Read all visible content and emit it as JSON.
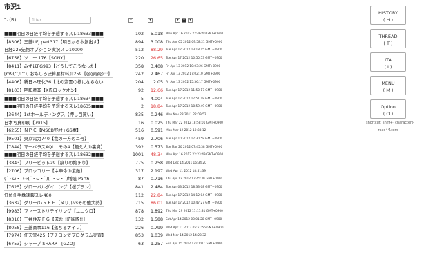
{
  "header": {
    "title": "市況1"
  },
  "toolbar": {
    "refresh_label": "ᔐ (R)",
    "filter_placeholder": "filter",
    "sort_buttons": [
      "▼",
      "▼",
      "▼",
      "▼",
      "▼"
    ]
  },
  "colors": {
    "hot_speed": "#dd3333",
    "text": "#222222"
  },
  "columns": [
    "name",
    "count",
    "speed",
    "created"
  ],
  "threads": [
    {
      "name": "■■■明日の日経平均を予想するスレ18633■■■",
      "count": "102",
      "speed": "5.018",
      "date": "Mon Apr 16 2012 22:46:40 GMT+0900",
      "hot": false
    },
    {
      "name": "【8306】三菱UFJ part317【明日から本気出す】",
      "count": "894",
      "speed": "3.008",
      "date": "Thu Apr 05 2012 09:58:21 GMT+0900",
      "hot": false
    },
    {
      "name": "日経225先物オプション実況スレ10000",
      "count": "512",
      "speed": "88.29",
      "date": "Tue Apr 17 2012 13:18:15 GMT+0900",
      "hot": true
    },
    {
      "name": "【6758】ソニー 176【SONY】",
      "count": "220",
      "speed": "26.65",
      "date": "Tue Apr 17 2012 10:50:53 GMT+0900",
      "hot": true
    },
    {
      "name": "【8411】みずほFG993【どうしてこうなった】",
      "count": "358",
      "speed": "3.408",
      "date": "Fri Apr 13 2012 10:03:26 GMT+0900",
      "hot": false
    },
    {
      "name": "[m9(^Д^)] おもしろ決算悪材料ｽﾚ259【@@@@:::】",
      "count": "242",
      "speed": "2.467",
      "date": "Fri Apr 13 2012 17:02:10 GMT+0900",
      "hot": false
    },
    {
      "name": "【4406】新日本理化36【北の紫雲の様にならない",
      "count": "204",
      "speed": "2.05",
      "date": "Fri Apr 13 2012 15:36:17 GMT+0900",
      "hot": false
    },
    {
      "name": "【8103】明和産業【K氏ロックオン】",
      "count": "92",
      "speed": "12.66",
      "date": "Tue Apr 17 2012 11:50:17 GMT+0900",
      "hot": true
    },
    {
      "name": "■■■明日の日経平均を予想するスレ18634■■■",
      "count": "5",
      "speed": "4.004",
      "date": "Tue Apr 17 2012 17:51:18 GMT+0900",
      "hot": false
    },
    {
      "name": "■■■明日の日経平均を予想するスレ18635■■■",
      "count": "2",
      "speed": "18.84",
      "date": "Tue Apr 17 2012 18:59:49 GMT+0900",
      "hot": true
    },
    {
      "name": "【3644】1stホールディングス【押し目買い】",
      "count": "835",
      "speed": "0.246",
      "date": "Mon Nov 28 2011 22:09:52",
      "hot": false
    },
    {
      "name": "日本写真印刷【7915】",
      "count": "16",
      "speed": "0.025",
      "date": "Thu Mar 22 2012 18:58:01 GMT+0900",
      "hot": false
    },
    {
      "name": "【6255】ＮＰＣ【MSCB野村+GS軍】",
      "count": "516",
      "speed": "0.591",
      "date": "Mon Mar 12 2012 10:38:12",
      "hot": false
    },
    {
      "name": "【9501】東京電力740【我の一方のニ号】",
      "count": "459",
      "speed": "2.706",
      "date": "Tue Apr 10 2012 17:30:58 GMT+0900",
      "hot": false
    },
    {
      "name": "【7844】マーベラスAQL　その4【鍛え人の裏資】",
      "count": "392",
      "speed": "0.573",
      "date": "Tue Mar 20 2012 07:45:38 GMT+0900",
      "hot": false
    },
    {
      "name": "■■■明日の日経平均を予想するスレ18632■■■",
      "count": "1001",
      "speed": "48.34",
      "date": "Mon Apr 16 2012 22:23:49 GMT+0900",
      "hot": true
    },
    {
      "name": "【3843】フリービット29【祭りの始まり】",
      "count": "775",
      "speed": "0.258",
      "date": "Wed Dec 14 2011 16:34:20",
      "hot": false
    },
    {
      "name": "【2706】ブロッコリー【ネ申今の素敵】",
      "count": "317",
      "speed": "2.197",
      "date": "Wed Apr 11 2012 18:51:39",
      "hot": false
    },
    {
      "name": "(´・ω・`)→(´・ω・`)(`・ω・´)増殖 Part6",
      "count": "87",
      "speed": "0.716",
      "date": "Thu Apr 12 2012 17:45:30 GMT+0900",
      "hot": false
    },
    {
      "name": "【7625】グローバルダイニング【桜プラン】",
      "count": "841",
      "speed": "2.484",
      "date": "Tue Apr 03 2012 18:33:08 GMT+0900",
      "hot": false
    },
    {
      "name": "低位仕手株速報スレ480",
      "count": "112",
      "speed": "22.84",
      "date": "Tue Apr 17 2012 14:12:04 GMT+0900",
      "hot": true
    },
    {
      "name": "【3632】グリー/ＧＲＥＥ【メリルvsその他大勢】",
      "count": "715",
      "speed": "86.01",
      "date": "Tue Apr 17 2012 10:47:27 GMT+0900",
      "hot": true
    },
    {
      "name": "【9983】ファーストリテイリング【ユニクロ】",
      "count": "878",
      "speed": "1.892",
      "date": "Thu Mar 29 2012 11:11:31 GMT+0900",
      "hot": false
    },
    {
      "name": "【8316】三井住友ＦＧ【求む!!防衛隊!!】",
      "count": "132",
      "speed": "1.588",
      "date": "Sat Apr 14 2012 08:01:28 GMT+0900",
      "hot": false
    },
    {
      "name": "【8058】三菱商事116【落ちるナイフ】",
      "count": "226",
      "speed": "0.799",
      "date": "Wed Apr 11 2012 05:51:55 GMT+0900",
      "hot": false
    },
    {
      "name": "【7974】任天堂425【プチコンでプログラム売買】",
      "count": "853",
      "speed": "1.039",
      "date": "Wed Mar 14 2012 14:28:32",
      "hot": false
    },
    {
      "name": "【6753】シャープ SHARP　[GZO]",
      "count": "63",
      "speed": "1.257",
      "date": "Sun Apr 15 2012 17:01:07 GMT+0900",
      "hot": false
    }
  ],
  "menu": [
    {
      "id": "history",
      "label": "HISTORY",
      "key": "( H )"
    },
    {
      "id": "thread",
      "label": "THREAD",
      "key": "( T )"
    },
    {
      "id": "ita",
      "label": "ITA",
      "key": "( I )"
    },
    {
      "id": "menu",
      "label": "MENU",
      "key": "( M )"
    },
    {
      "id": "option",
      "label": "Option",
      "key": "( O )"
    }
  ],
  "shortcut_hint": "shortcut: shift+{character}",
  "site": "read44.com"
}
